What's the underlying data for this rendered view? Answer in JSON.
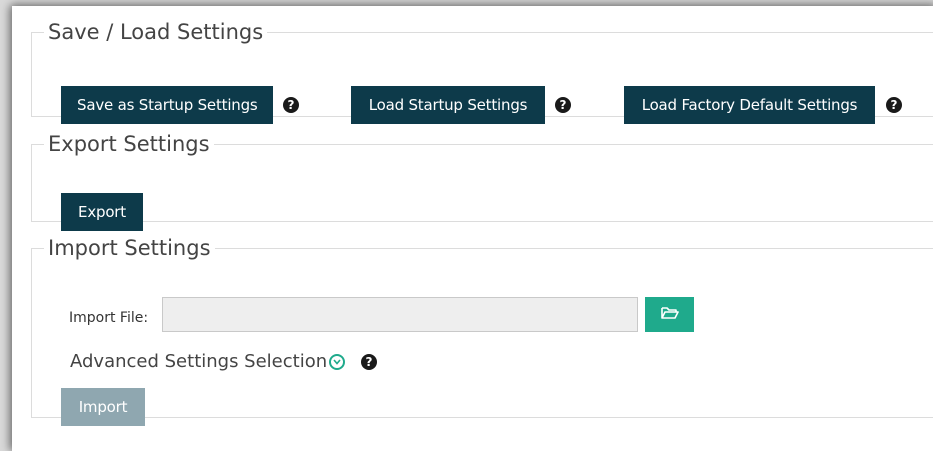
{
  "save_load": {
    "legend": "Save / Load Settings",
    "save_startup": "Save as Startup Settings",
    "load_startup": "Load Startup Settings",
    "load_factory": "Load Factory Default Settings",
    "help": "?"
  },
  "export": {
    "legend": "Export Settings",
    "button": "Export"
  },
  "import": {
    "legend": "Import Settings",
    "file_label": "Import File:",
    "file_value": "",
    "advanced_label": "Advanced Settings Selection",
    "button": "Import",
    "help": "?"
  },
  "colors": {
    "primary_button": "#0d3a4a",
    "disabled_button": "#8fa7b0",
    "accent": "#1faa8c"
  },
  "icons": {
    "browse": "folder-open-icon",
    "expand": "chevron-down-circle-icon",
    "help": "question-circle-icon"
  }
}
